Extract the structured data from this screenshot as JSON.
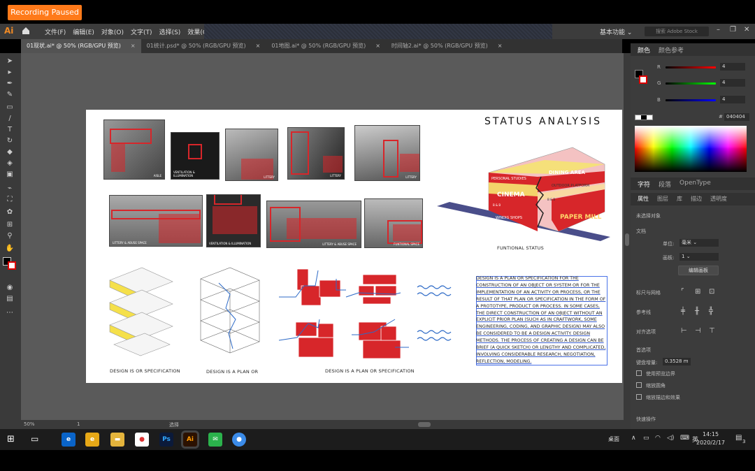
{
  "recording": {
    "label": "Recording Paused"
  },
  "app": {
    "logo": "Ai",
    "menus": [
      "文件(F)",
      "编辑(E)",
      "对象(O)",
      "文字(T)",
      "选择(S)",
      "效果(C)"
    ],
    "workspace": "基本功能",
    "search_placeholder": "搜索 Adobe Stock"
  },
  "tabs": [
    {
      "label": "01现状.ai* @ 50% (RGB/GPU 预览)",
      "active": true
    },
    {
      "label": "01统计.psd* @ 50% (RGB/GPU 预览)",
      "active": false
    },
    {
      "label": "01地图.ai* @ 50% (RGB/GPU 预览)",
      "active": false
    },
    {
      "label": "时间轴2.ai* @ 50% (RGB/GPU 预览)",
      "active": false
    }
  ],
  "artboard": {
    "title": "STATUS ANALYSIS",
    "photo_captions": [
      "AISLE",
      "VENTILATION & ILLUMINATION",
      "LITTERY",
      "LITTERY",
      "LITTERY",
      "LITTERY & ABUSE SPACE",
      "VENTILATION & ILLUMINATION",
      "LITTERY & ABUSE SPACE",
      "FUNTIONAL SPACE"
    ],
    "model_labels": [
      "PERSONAL STUDIES",
      "DINING AREA",
      "OUTDOOR PLATFORM",
      "CINEMA",
      "B & B",
      "PAPER MILL",
      "B & B",
      "WINDIG SHOPS"
    ],
    "functional_status": "FUNTIONAL STATUS",
    "diagram_captions": [
      "DESIGN IS OR SPECIFICATION",
      "DESIGN IS A PLAN OR",
      "DESIGN IS A PLAN OR SPECIFICATION"
    ],
    "body_text": "DESIGN IS A PLAN OR SPECIFICATION FOR THE CONSTRUCTION OF AN OBJECT OR SYSTEM OR FOR THE IMPLEMENTATION OF AN ACTIVITY OR PROCESS, OR THE RESULT OF THAT PLAN OR SPECIFICATION IN THE FORM OF A PROTOTYPE, PRODUCT OR PROCESS.  IN SOME CASES, THE DIRECT CONSTRUCTION OF AN OBJECT WITHOUT AN EXPLICIT PRIOR PLAN (SUCH AS IN CRAFTWORK, SOME ENGINEERING, CODING, AND GRAPHIC DESIGN) MAY ALSO BE CONSIDERED TO BE A DESIGN ACTIVITY. DESIGN METHODS. THE PROCESS OF CREATING A DESIGN CAN BE BRIEF (A QUICK SKETCH) OR LENGTHY AND COMPLICATED, INVOLVING CONSIDERABLE RESEARCH, NEGOTIATION, REFLECTION, MODELING."
  },
  "statusbar": {
    "zoom": "50%",
    "page": "1",
    "mode": "选择"
  },
  "color_panel": {
    "tabs": [
      "颜色",
      "颜色参考"
    ],
    "channels": [
      {
        "name": "R",
        "value": "4"
      },
      {
        "name": "G",
        "value": "4"
      },
      {
        "name": "B",
        "value": "4"
      }
    ],
    "hex": "040404"
  },
  "char_panel": {
    "tabs": [
      "字符",
      "段落",
      "OpenType"
    ]
  },
  "props_panel": {
    "tabs": [
      "属性",
      "图层",
      "库",
      "描边",
      "透明度"
    ],
    "no_selection": "未选择对象",
    "doc_label": "文档",
    "units_label": "单位:",
    "units_value": "毫米",
    "artboard_label": "画板:",
    "artboard_value": "1",
    "edit_artboard": "编辑画板",
    "ruler_grid": "标尺与网格",
    "guides": "参考线",
    "snap": "对齐选项",
    "prefs": "首选项",
    "keyboard_inc_label": "键盘增量:",
    "keyboard_inc_value": "0.3528",
    "keyboard_inc_unit": "m",
    "checks": [
      "使用预览边界",
      "缩放圆角",
      "缩放描边和效果"
    ],
    "quick_actions": "快速操作"
  },
  "taskbar": {
    "desktop": "桌面",
    "lang": "英",
    "time": "14:15",
    "date": "2020/2/17",
    "notif": "3"
  },
  "colors": {
    "accent_red": "#d7262a",
    "recording": "#ff7a1a"
  }
}
